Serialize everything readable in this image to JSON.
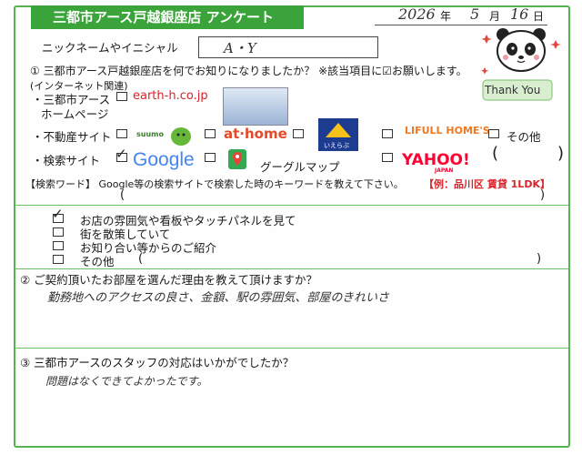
{
  "header": {
    "title": "三都市アース戸越銀座店 アンケート",
    "date_year": "2026",
    "date_year_unit": "年",
    "date_month": "5",
    "date_month_unit": "月",
    "date_day": "16",
    "date_day_unit": "日"
  },
  "nickname": {
    "label": "ニックネームやイニシャル",
    "value": "A・Y"
  },
  "mascot": {
    "thank_you": "Thank You",
    "icon": "panda-icon"
  },
  "q1": {
    "question": "① 三都市アース戸越銀座店を何でお知りになりましたか？ ※該当項目に☑お願いします。",
    "sub": "(インターネット関連)",
    "homepage_label_1": "・三都市アース",
    "homepage_label_2": "ホームページ",
    "homepage_logo": "earth-h.co.jp",
    "realestate_label": "・不動産サイト",
    "suumo": "suumo",
    "athome": "at·home",
    "lifull": "LIFULL HOME'S",
    "ieichiba": "いえらぶ",
    "other": "その他",
    "search_label": "・検索サイト",
    "google": "Google",
    "googlemaps": "グーグルマップ",
    "yahoo": "YAHOO!",
    "yahoo_japan": "JAPAN",
    "keyword_label": "【検索ワード】 Google等の検索サイトで検索した時のキーワードを教えて下さい。",
    "keyword_example": "【例：品川区 賃貸 1LDK】",
    "open_paren": "(",
    "close_paren": ")"
  },
  "q1b": {
    "items": [
      {
        "label": "お店の雰囲気や看板やタッチパネルを見て",
        "checked": true
      },
      {
        "label": "街を散策していて",
        "checked": false
      },
      {
        "label": "お知り合い等からのご紹介",
        "checked": false
      },
      {
        "label": "その他",
        "checked": false
      }
    ]
  },
  "q2": {
    "question": "② ご契約頂いたお部屋を選んだ理由を教えて頂けますか？",
    "answer": "勤務地へのアクセスの良さ、金額、駅の雰囲気、部屋のきれいさ"
  },
  "q3": {
    "question": "③ 三都市アースのスタッフの対応はいかがでしたか？",
    "answer": "問題はなくできてよかったです。"
  },
  "colors": {
    "brand_green": "#3aa43a",
    "border_green": "#55b44f",
    "example_red": "#d8232a"
  }
}
